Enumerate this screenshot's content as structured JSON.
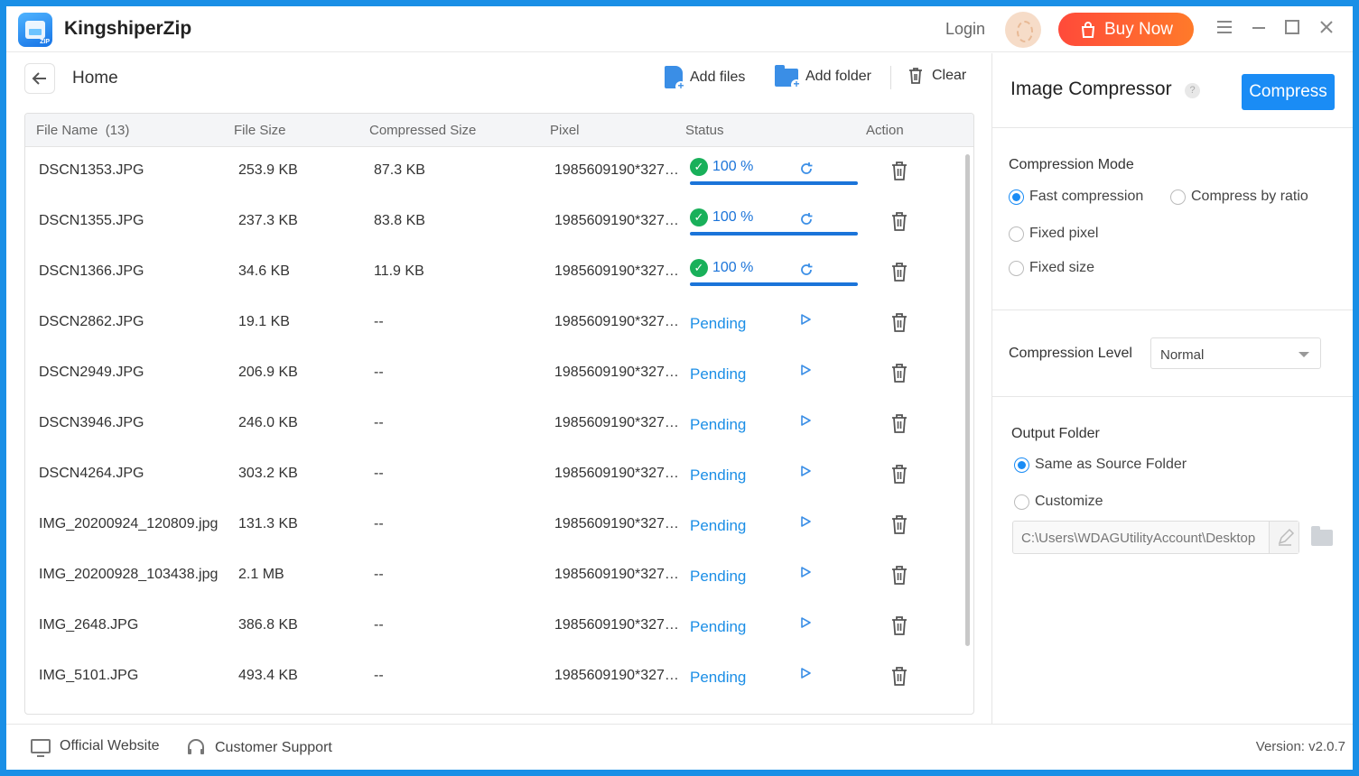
{
  "app": {
    "title": "KingshiperZip",
    "logo_text": "ZIP"
  },
  "titlebar": {
    "login_label": "Login",
    "buy_label": "Buy Now"
  },
  "toolbar": {
    "home_label": "Home",
    "add_files_label": "Add files",
    "add_folder_label": "Add folder",
    "clear_label": "Clear"
  },
  "table": {
    "headers": {
      "file_name": "File Name",
      "file_count": "(13)",
      "file_size": "File Size",
      "compressed_size": "Compressed Size",
      "pixel": "Pixel",
      "status": "Status",
      "action": "Action"
    },
    "rows": [
      {
        "name": "DSCN1353.JPG",
        "size": "253.9 KB",
        "compressed": "87.3 KB",
        "pixel": "1985609190*3276...",
        "status": "done",
        "percent": "100 %"
      },
      {
        "name": "DSCN1355.JPG",
        "size": "237.3 KB",
        "compressed": "83.8 KB",
        "pixel": "1985609190*3276...",
        "status": "done",
        "percent": "100 %"
      },
      {
        "name": "DSCN1366.JPG",
        "size": "34.6 KB",
        "compressed": "11.9 KB",
        "pixel": "1985609190*3276...",
        "status": "done",
        "percent": "100 %"
      },
      {
        "name": "DSCN2862.JPG",
        "size": "19.1 KB",
        "compressed": "--",
        "pixel": "1985609190*3276...",
        "status": "Pending"
      },
      {
        "name": "DSCN2949.JPG",
        "size": "206.9 KB",
        "compressed": "--",
        "pixel": "1985609190*3276...",
        "status": "Pending"
      },
      {
        "name": "DSCN3946.JPG",
        "size": "246.0 KB",
        "compressed": "--",
        "pixel": "1985609190*3276...",
        "status": "Pending"
      },
      {
        "name": "DSCN4264.JPG",
        "size": "303.2 KB",
        "compressed": "--",
        "pixel": "1985609190*3276...",
        "status": "Pending"
      },
      {
        "name": "IMG_20200924_120809.jpg",
        "size": "131.3 KB",
        "compressed": "--",
        "pixel": "1985609190*3276...",
        "status": "Pending"
      },
      {
        "name": "IMG_20200928_103438.jpg",
        "size": "2.1 MB",
        "compressed": "--",
        "pixel": "1985609190*3276...",
        "status": "Pending"
      },
      {
        "name": "IMG_2648.JPG",
        "size": "386.8 KB",
        "compressed": "--",
        "pixel": "1985609190*3276...",
        "status": "Pending"
      },
      {
        "name": "IMG_5101.JPG",
        "size": "493.4 KB",
        "compressed": "--",
        "pixel": "1985609190*3276...",
        "status": "Pending"
      }
    ]
  },
  "right_panel": {
    "title": "Image Compressor",
    "help_glyph": "?",
    "compress_label": "Compress",
    "mode_label": "Compression Mode",
    "modes": [
      "Fast compression",
      "Compress by ratio",
      "Fixed pixel",
      "Fixed size"
    ],
    "selected_mode": "Fast compression",
    "level_label": "Compression Level",
    "level_value": "Normal",
    "output_label": "Output Folder",
    "output_options": [
      "Same as Source Folder",
      "Customize"
    ],
    "selected_output": "Same as Source Folder",
    "output_path": "C:\\Users\\WDAGUtilityAccount\\Desktop"
  },
  "footer": {
    "website_label": "Official Website",
    "support_label": "Customer Support",
    "version": "Version: v2.0.7"
  },
  "colors": {
    "accent": "#1a8cf5",
    "success": "#19b05a",
    "buy_start": "#ff4a3a",
    "buy_end": "#ff7a2a"
  }
}
